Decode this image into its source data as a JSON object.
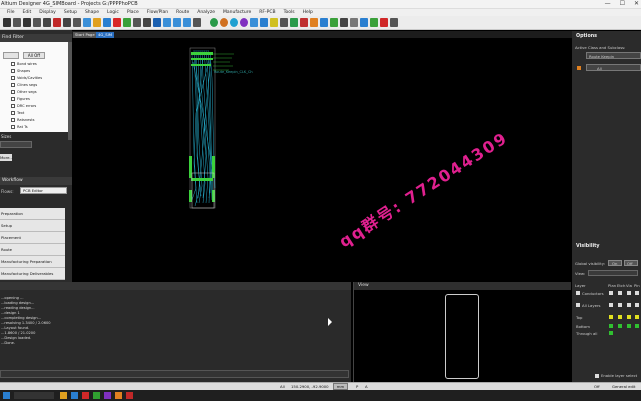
{
  "window": {
    "title": "Altium Designer 4G_SIMBoard - Projects G:/PPPPhoPCB",
    "minimize_label": "—",
    "maximize_label": "☐",
    "close_label": "✕"
  },
  "menu": [
    "File",
    "Edit",
    "Display",
    "Setup",
    "Shape",
    "Logic",
    "Place",
    "Flow/Plan",
    "Route",
    "Analyze",
    "Manufacture",
    "RF-PCB",
    "Tools",
    "Help"
  ],
  "doc_tabs": [
    "Start Page",
    "4G_SIM"
  ],
  "find_filter": {
    "title": "Find Filter",
    "all_off_label": "All Off",
    "items": [
      "Bond wires",
      "Shapes",
      "Voids/Cavities",
      "Clines segs",
      "Other segs",
      "Figures",
      "DRC errors",
      "Text",
      "Ratsnests",
      "Rat Ts"
    ]
  },
  "left_labels": {
    "sizes": "Sizes",
    "more_btn": "More..."
  },
  "workflow": {
    "title": "Workflow",
    "flows_label": "Flows:",
    "flow_selected": "PCB Editor",
    "steps": [
      "Preparation",
      "Setup",
      "Placement",
      "Route",
      "Manufacturing Preparation",
      "Manufacturing Deliverables"
    ]
  },
  "output": {
    "lines": [
      "...opening ...",
      "...loading design...",
      "...reading design...",
      "...design 1",
      "...completing design...",
      "...resolving 1.3400 / 2.0600",
      "...Layout found.",
      "...1.8600 / 21.0200",
      "...Design loaded.",
      "...Done."
    ]
  },
  "view_panel": {
    "title": "View"
  },
  "options": {
    "title": "Options",
    "subtitle": "Active Class and Subclass:",
    "class_value": "Route Keepin",
    "sub_value": "All"
  },
  "visibility": {
    "title": "Visibility",
    "global_label": "Global visibility:",
    "on_label": "On",
    "off_label": "Off",
    "view_label": "View:",
    "layer_label": "Layer",
    "plan_label": "Plan",
    "etch_label": "Etch",
    "via_label": "Via",
    "pin_label": "Pin",
    "rows": [
      "Conductors",
      "All Layers",
      "Top",
      "Bottom",
      "Through all"
    ],
    "enable_layer_select": "Enable layer select",
    "off_check_label": "Off",
    "general_edit": "General edit"
  },
  "status": {
    "mode": "All",
    "coords": "150.2900, -92.9000",
    "units": "mm",
    "p_label": "P",
    "a_label": "A"
  },
  "watermark": "qq群号: 772044309",
  "silk_label": "Route_Keepin_CLK_Ch",
  "colors": {
    "accent_magenta": "#e0208f",
    "route_cyan": "#28b8d8",
    "green": "#3cd23c",
    "panel_bg": "#2b2b2b"
  }
}
